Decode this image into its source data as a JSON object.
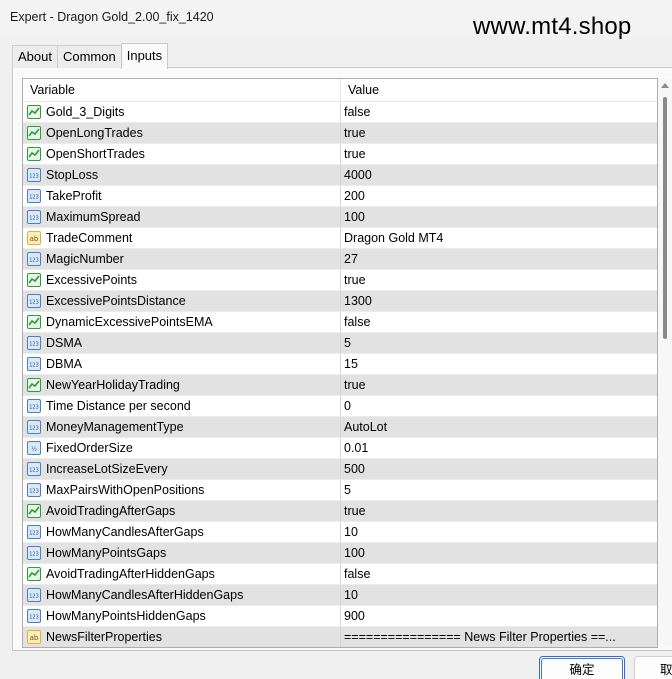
{
  "window": {
    "title": "Expert - Dragon Gold_2.00_fix_1420",
    "watermark": "www.mt4.shop"
  },
  "tabs": [
    {
      "label": "About",
      "active": false
    },
    {
      "label": "Common",
      "active": false
    },
    {
      "label": "Inputs",
      "active": true
    }
  ],
  "table": {
    "headers": {
      "variable": "Variable",
      "value": "Value"
    },
    "rows": [
      {
        "name": "Gold_3_Digits",
        "value": "false",
        "icon": "bool-chart-icon"
      },
      {
        "name": "OpenLongTrades",
        "value": "true",
        "icon": "bool-chart-icon"
      },
      {
        "name": "OpenShortTrades",
        "value": "true",
        "icon": "bool-chart-icon"
      },
      {
        "name": "StopLoss",
        "value": "4000",
        "icon": "integer-icon"
      },
      {
        "name": "TakeProfit",
        "value": "200",
        "icon": "integer-icon"
      },
      {
        "name": "MaximumSpread",
        "value": "100",
        "icon": "integer-icon"
      },
      {
        "name": "TradeComment",
        "value": "Dragon Gold MT4",
        "icon": "string-icon"
      },
      {
        "name": "MagicNumber",
        "value": "27",
        "icon": "integer-icon"
      },
      {
        "name": "ExcessivePoints",
        "value": "true",
        "icon": "bool-chart-icon"
      },
      {
        "name": "ExcessivePointsDistance",
        "value": "1300",
        "icon": "integer-icon"
      },
      {
        "name": "DynamicExcessivePointsEMA",
        "value": "false",
        "icon": "bool-chart-icon"
      },
      {
        "name": "DSMA",
        "value": "5",
        "icon": "integer-icon"
      },
      {
        "name": "DBMA",
        "value": "15",
        "icon": "integer-icon"
      },
      {
        "name": "NewYearHolidayTrading",
        "value": "true",
        "icon": "bool-chart-icon"
      },
      {
        "name": "Time Distance per second",
        "value": "0",
        "icon": "integer-icon"
      },
      {
        "name": "MoneyManagementType",
        "value": "AutoLot",
        "icon": "integer-icon"
      },
      {
        "name": "FixedOrderSize",
        "value": "0.01",
        "icon": "double-icon"
      },
      {
        "name": "IncreaseLotSizeEvery",
        "value": "500",
        "icon": "integer-icon"
      },
      {
        "name": "MaxPairsWithOpenPositions",
        "value": "5",
        "icon": "integer-icon"
      },
      {
        "name": "AvoidTradingAfterGaps",
        "value": "true",
        "icon": "bool-chart-icon"
      },
      {
        "name": "HowManyCandlesAfterGaps",
        "value": "10",
        "icon": "integer-icon"
      },
      {
        "name": "HowManyPointsGaps",
        "value": "100",
        "icon": "integer-icon"
      },
      {
        "name": "AvoidTradingAfterHiddenGaps",
        "value": "false",
        "icon": "bool-chart-icon"
      },
      {
        "name": "HowManyCandlesAfterHiddenGaps",
        "value": "10",
        "icon": "integer-icon"
      },
      {
        "name": "HowManyPointsHiddenGaps",
        "value": "900",
        "icon": "integer-icon"
      },
      {
        "name": "NewsFilterProperties",
        "value": "================ News Filter Properties ==...",
        "icon": "string-icon"
      }
    ]
  },
  "buttons": {
    "ok": "确定",
    "cancel": "取"
  },
  "colors": {
    "row_alt": "#e2e2e2",
    "bool_icon": "#2f9a3a",
    "int_icon": "#4a7fc0",
    "string_icon": "#d9b340",
    "accent": "#2e6bd6"
  }
}
